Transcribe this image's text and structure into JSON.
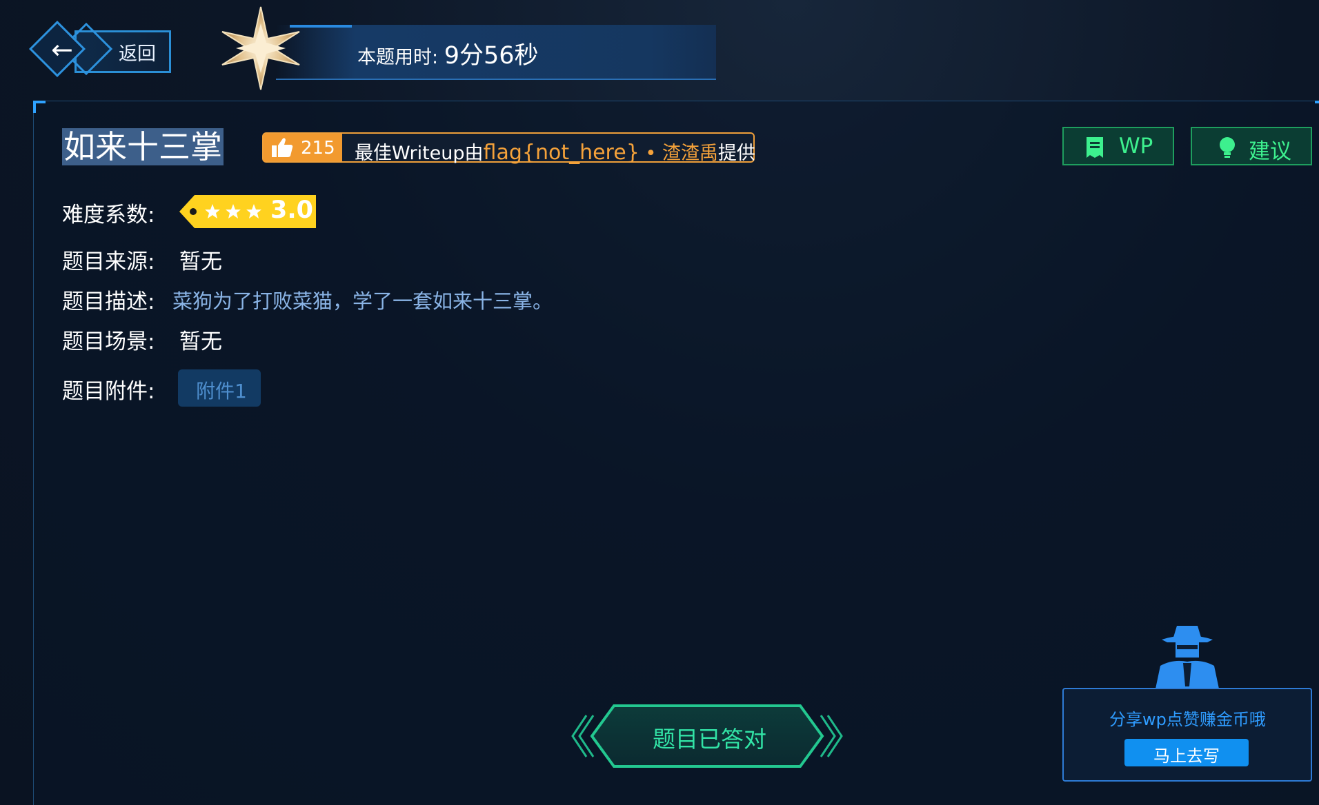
{
  "header": {
    "back_label": "返回",
    "timer_label": "本题用时: ",
    "timer_value": "9分56秒"
  },
  "challenge": {
    "title": "如来十三掌",
    "likes": "215",
    "writeup_prefix": "最佳Writeup由",
    "writeup_flag": "flag{not_here}",
    "writeup_separator": " • ",
    "writeup_author": "渣渣禹",
    "writeup_suffix": "提供",
    "difficulty_label": "难度系数:",
    "difficulty_value": "3.0",
    "difficulty_stars": 3,
    "source_label": "题目来源:",
    "source_value": "暂无",
    "desc_label": "题目描述:",
    "desc_value": "菜狗为了打败菜猫，学了一套如来十三掌。",
    "scene_label": "题目场景:",
    "scene_value": "暂无",
    "attach_label": "题目附件:",
    "attach_button": "附件1",
    "answered_label": "题目已答对"
  },
  "side": {
    "wp_label": "WP",
    "suggest_label": "建议"
  },
  "share": {
    "text": "分享wp点赞赚金币哦",
    "button": "马上去写"
  },
  "colors": {
    "accent_blue": "#2fa2ff",
    "accent_orange": "#f29a2f",
    "accent_green": "#3df08e",
    "accent_teal": "#32e3a6",
    "difficulty_yellow": "#ffd21f"
  }
}
